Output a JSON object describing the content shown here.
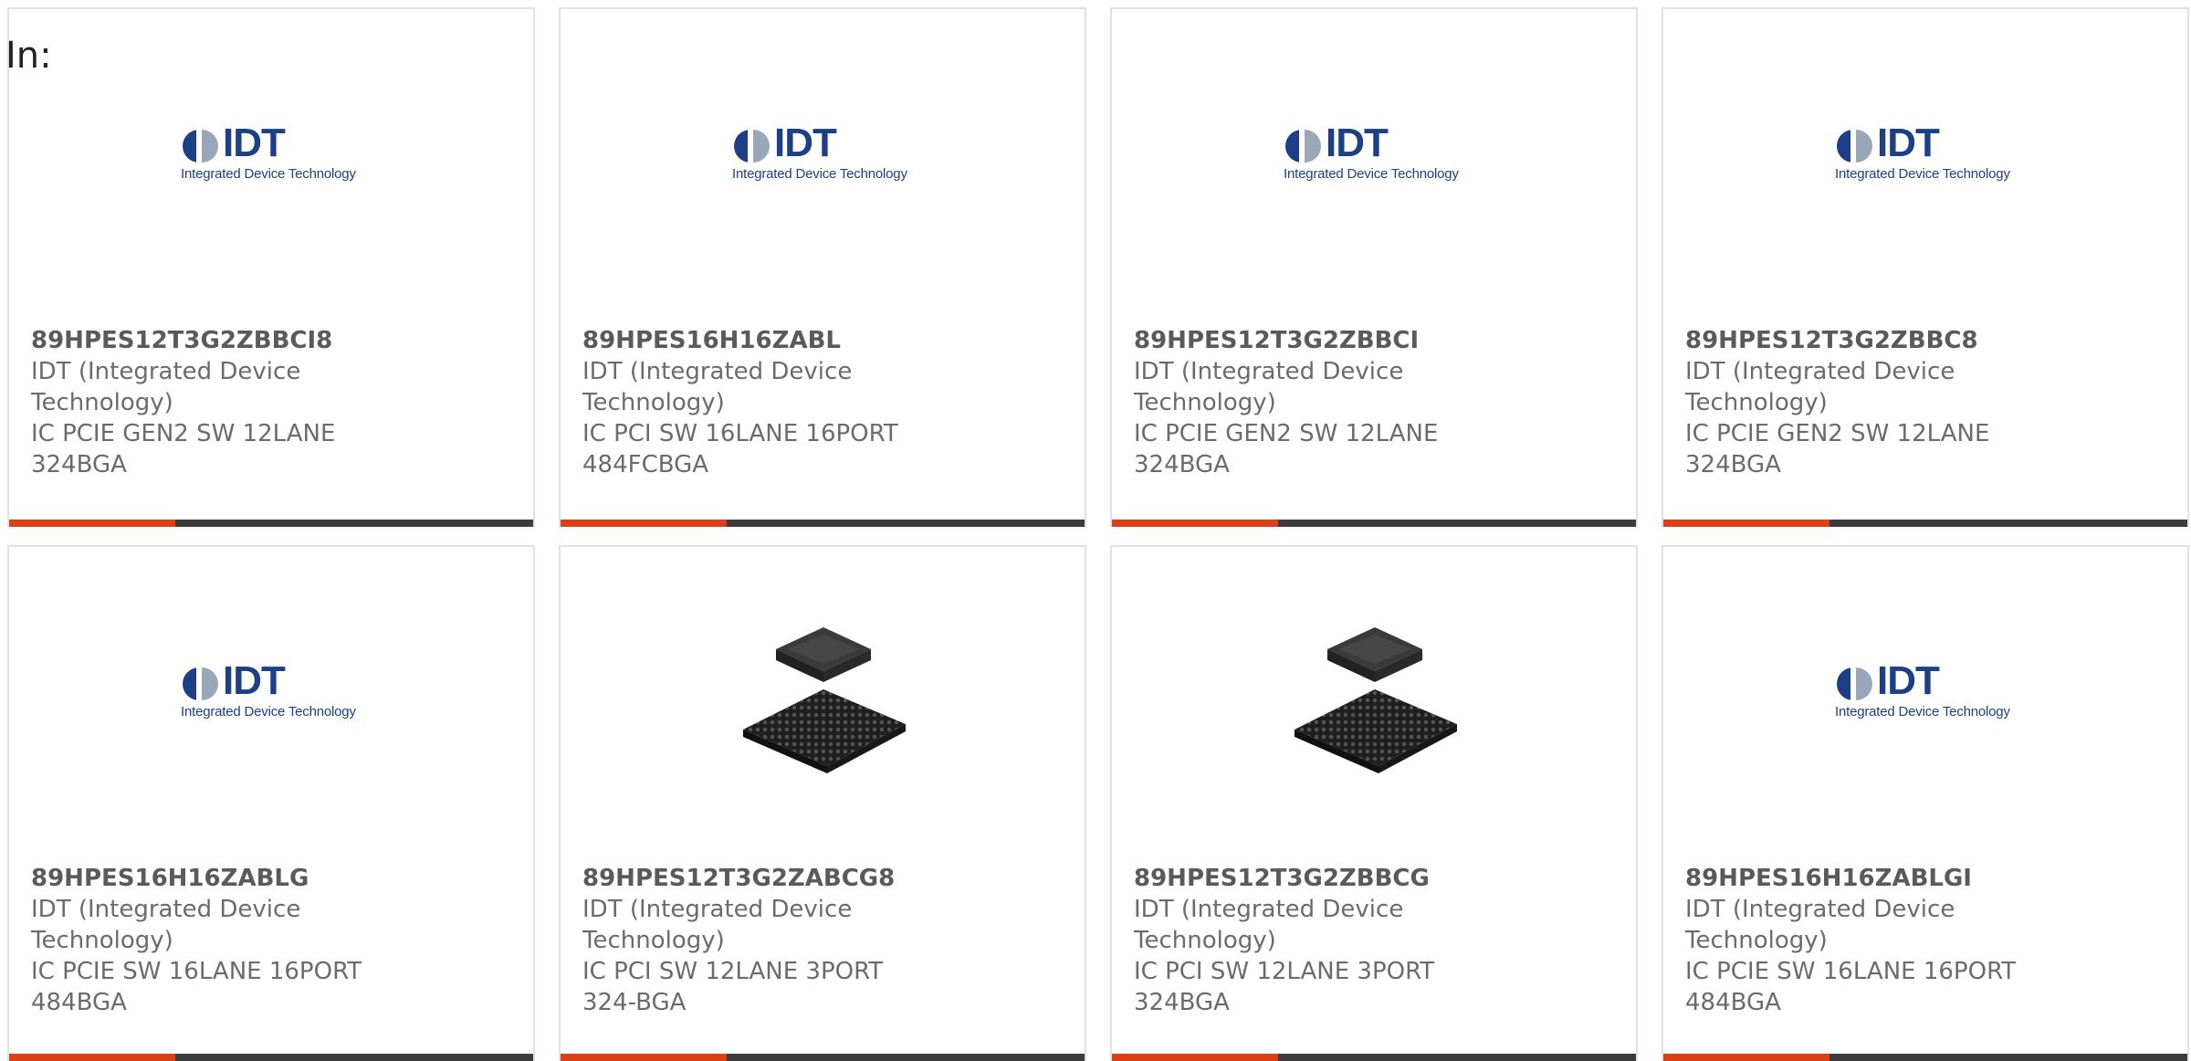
{
  "filter": {
    "label": "In:"
  },
  "brand": {
    "logo_text": "IDT",
    "logo_sub": "Integrated Device Technology"
  },
  "products": [
    {
      "part": "89HPES12T3G2ZBBCI8",
      "manufacturer": "IDT (Integrated Device Technology)",
      "description": "IC PCIE GEN2 SW 12LANE 324BGA",
      "image": "idt-logo"
    },
    {
      "part": "89HPES16H16ZABL",
      "manufacturer": "IDT (Integrated Device Technology)",
      "description": "IC PCI SW 16LANE 16PORT 484FCBGA",
      "image": "idt-logo"
    },
    {
      "part": "89HPES12T3G2ZBBCI",
      "manufacturer": "IDT (Integrated Device Technology)",
      "description": "IC PCIE GEN2 SW 12LANE 324BGA",
      "image": "idt-logo"
    },
    {
      "part": "89HPES12T3G2ZBBC8",
      "manufacturer": "IDT (Integrated Device Technology)",
      "description": "IC PCIE GEN2 SW 12LANE 324BGA",
      "image": "idt-logo"
    },
    {
      "part": "89HPES16H16ZABLG",
      "manufacturer": "IDT (Integrated Device Technology)",
      "description": "IC PCIE SW 16LANE 16PORT 484BGA",
      "image": "idt-logo"
    },
    {
      "part": "89HPES12T3G2ZABCG8",
      "manufacturer": "IDT (Integrated Device Technology)",
      "description": "IC PCI SW 12LANE 3PORT 324-BGA",
      "image": "bga-chip"
    },
    {
      "part": "89HPES12T3G2ZBBCG",
      "manufacturer": "IDT (Integrated Device Technology)",
      "description": "IC PCI SW 12LANE 3PORT 324BGA",
      "image": "bga-chip"
    },
    {
      "part": "89HPES16H16ZABLGI",
      "manufacturer": "IDT (Integrated Device Technology)",
      "description": "IC PCIE SW 16LANE 16PORT 484BGA",
      "image": "idt-logo"
    }
  ],
  "colors": {
    "accent": "#dd3f17",
    "bar": "#3c3c3c",
    "brand": "#1c3f87",
    "text": "#6b6b6b"
  }
}
